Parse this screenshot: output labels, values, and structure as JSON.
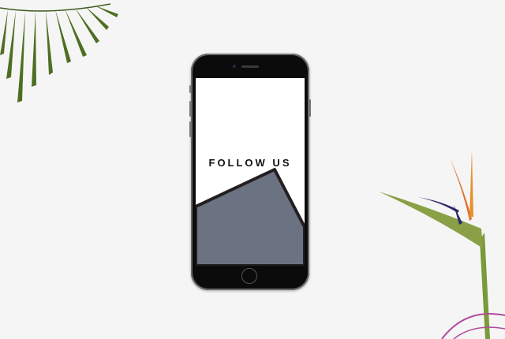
{
  "screen": {
    "headline": "FOLLOW US"
  },
  "colors": {
    "background": "#f5f5f5",
    "shape_fill": "#6b7282",
    "shape_border": "#231f20",
    "phone_body": "#0b0b0c"
  }
}
